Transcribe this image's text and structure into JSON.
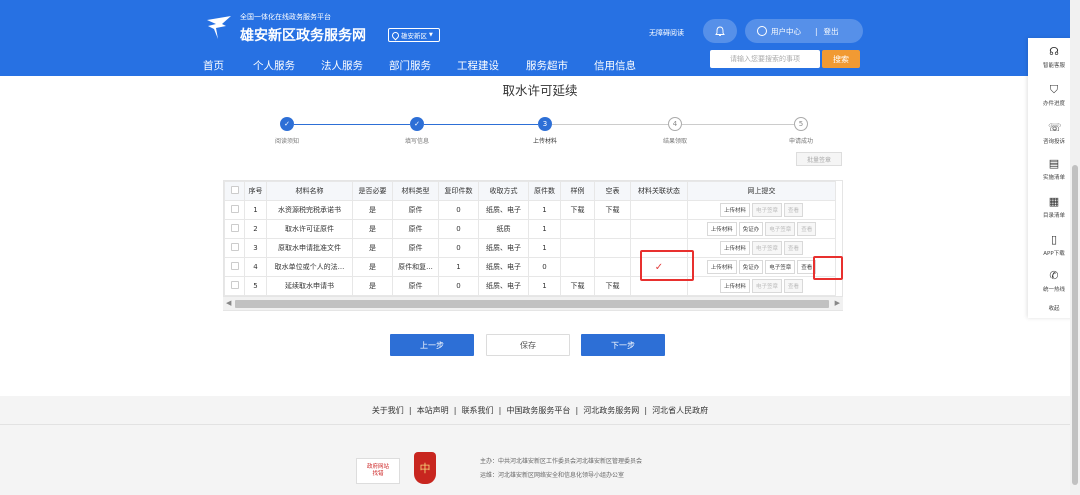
{
  "header": {
    "subtitle": "全国一体化在线政务服务平台",
    "title": "雄安新区政务服务网",
    "region": "雄安新区",
    "accessibility": "无障碍阅读",
    "user_center": "用户中心",
    "logout": "登出",
    "search_placeholder": "请输入您要搜索的事项",
    "search_button": "搜索",
    "nav": [
      "首页",
      "个人服务",
      "法人服务",
      "部门服务",
      "工程建设",
      "服务超市",
      "信用信息"
    ]
  },
  "page": {
    "title": "取水许可延续"
  },
  "steps": [
    {
      "label": "阅读须知",
      "state": "done",
      "num": "1"
    },
    {
      "label": "填写信息",
      "state": "done",
      "num": "2"
    },
    {
      "label": "上传材料",
      "state": "current",
      "num": "3"
    },
    {
      "label": "结果领取",
      "state": "todo",
      "num": "4"
    },
    {
      "label": "申请成功",
      "state": "todo",
      "num": "5"
    }
  ],
  "batch_button": "批量签章",
  "table": {
    "headers": [
      "",
      "序号",
      "材料名称",
      "是否必要",
      "材料类型",
      "复印件数",
      "收取方式",
      "原件数",
      "样例",
      "空表",
      "材料关联状态",
      "网上提交"
    ],
    "rows": [
      {
        "no": "1",
        "name": "水资源税完税承诺书",
        "required": "是",
        "type": "原件",
        "copies": "0",
        "method": "纸质、电子",
        "originals": "1",
        "sample": "下载",
        "blank": "下载",
        "status": "",
        "actions": [
          {
            "t": "上传材料",
            "d": false
          },
          {
            "t": "电子签章",
            "d": true
          },
          {
            "t": "查看",
            "d": true
          }
        ]
      },
      {
        "no": "2",
        "name": "取水许可证原件",
        "required": "是",
        "type": "原件",
        "copies": "0",
        "method": "纸质",
        "originals": "1",
        "sample": "",
        "blank": "",
        "status": "",
        "actions": [
          {
            "t": "上传材料",
            "d": false
          },
          {
            "t": "免证办",
            "d": false
          },
          {
            "t": "电子签章",
            "d": true
          },
          {
            "t": "查看",
            "d": true
          }
        ]
      },
      {
        "no": "3",
        "name": "原取水申请批准文件",
        "required": "是",
        "type": "原件",
        "copies": "0",
        "method": "纸质、电子",
        "originals": "1",
        "sample": "",
        "blank": "",
        "status": "",
        "actions": [
          {
            "t": "上传材料",
            "d": false
          },
          {
            "t": "电子签章",
            "d": true
          },
          {
            "t": "查看",
            "d": true
          }
        ]
      },
      {
        "no": "4",
        "name": "取水单位或个人的法...",
        "required": "是",
        "type": "原件和复...",
        "copies": "1",
        "method": "纸质、电子",
        "originals": "0",
        "sample": "",
        "blank": "",
        "status": "✓",
        "actions": [
          {
            "t": "上传材料",
            "d": false
          },
          {
            "t": "免证办",
            "d": false
          },
          {
            "t": "电子签章",
            "d": false
          },
          {
            "t": "查看",
            "d": false
          }
        ]
      },
      {
        "no": "5",
        "name": "延续取水申请书",
        "required": "是",
        "type": "原件",
        "copies": "0",
        "method": "纸质、电子",
        "originals": "1",
        "sample": "下载",
        "blank": "下载",
        "status": "",
        "actions": [
          {
            "t": "上传材料",
            "d": false
          },
          {
            "t": "电子签章",
            "d": true
          },
          {
            "t": "查看",
            "d": true
          }
        ]
      }
    ]
  },
  "buttons": {
    "prev": "上一步",
    "save": "保存",
    "next": "下一步"
  },
  "footer": {
    "links": [
      "关于我们",
      "本站声明",
      "联系我们",
      "中国政务服务平台",
      "河北政务服务网",
      "河北省人民政府"
    ],
    "sponsor": "主办：中共河北雄安新区工作委员会河北雄安新区管理委员会",
    "operator": "运维：河北雄安新区网络安全和信息化领导小组办公室",
    "badge_line1": "政府网站",
    "badge_line2": "找错",
    "badge2_glyph": "中"
  },
  "sidebar": [
    "智能客服",
    "办件进度",
    "咨询投诉",
    "实施清单",
    "目录清单",
    "APP下载",
    "统一热线",
    "收起"
  ],
  "colors": {
    "header": "#2771e3",
    "primary": "#2d6fd6",
    "search": "#f19a33",
    "highlight": "#e8302e"
  }
}
